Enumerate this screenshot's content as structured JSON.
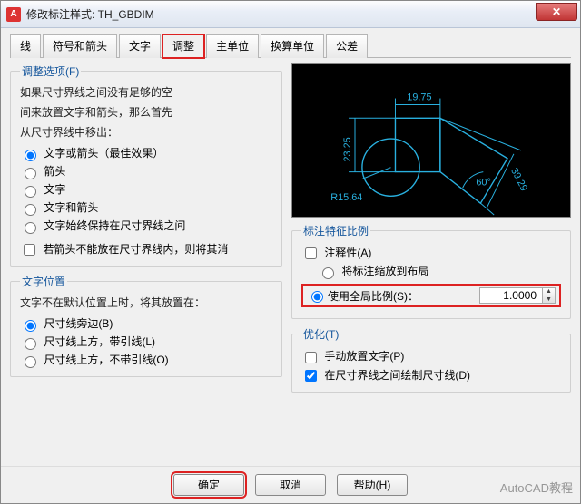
{
  "window": {
    "title": "修改标注样式: TH_GBDIM"
  },
  "tabs": {
    "t0": "线",
    "t1": "符号和箭头",
    "t2": "文字",
    "t3": "调整",
    "t4": "主单位",
    "t5": "换算单位",
    "t6": "公差"
  },
  "fit": {
    "legend": "调整选项(F)",
    "desc1": "如果尺寸界线之间没有足够的空",
    "desc2": "间来放置文字和箭头，那么首先",
    "desc3": "从尺寸界线中移出：",
    "opt0": "文字或箭头（最佳效果）",
    "opt1": "箭头",
    "opt2": "文字",
    "opt3": "文字和箭头",
    "opt4": "文字始终保持在尺寸界线之间",
    "chk": "若箭头不能放在尺寸界线内，则将其消"
  },
  "textpos": {
    "legend": "文字位置",
    "desc": "文字不在默认位置上时，将其放置在：",
    "opt0": "尺寸线旁边(B)",
    "opt1": "尺寸线上方，带引线(L)",
    "opt2": "尺寸线上方，不带引线(O)"
  },
  "scale": {
    "legend": "标注特征比例",
    "annotative": "注释性(A)",
    "fitlayout": "将标注缩放到布局",
    "useglobal": "使用全局比例(S)：",
    "value": "1.0000"
  },
  "tune": {
    "legend": "优化(T)",
    "manual": "手动放置文字(P)",
    "drawdim": "在尺寸界线之间绘制尺寸线(D)"
  },
  "preview": {
    "d1": "19.75",
    "d2": "23.25",
    "d3": "39.29",
    "d4": "60°",
    "d5": "R15.64"
  },
  "footer": {
    "ok": "确定",
    "cancel": "取消",
    "help": "帮助(H)"
  },
  "watermark": "AutoCAD教程"
}
